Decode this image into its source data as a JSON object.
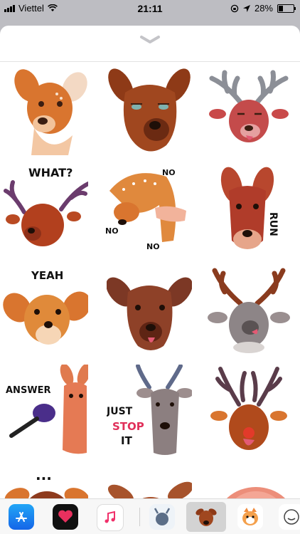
{
  "status_bar": {
    "carrier": "Viettel",
    "time": "21:11",
    "battery": "28%",
    "battery_level": 0.28,
    "icons": [
      "signal-bars-icon",
      "wifi-icon",
      "rotation-lock-icon",
      "location-arrow-icon",
      "battery-icon"
    ]
  },
  "sheet": {
    "grabber_icon": "chevron-down-icon"
  },
  "stickers": [
    {
      "name": "sticker-deer-doe-smirk",
      "text": ""
    },
    {
      "name": "sticker-deer-tired-eyes",
      "text": ""
    },
    {
      "name": "sticker-deer-antlers-tongue",
      "text": ""
    },
    {
      "name": "sticker-deer-what",
      "text": "WHAT?"
    },
    {
      "name": "sticker-deer-no-no",
      "text": "NO",
      "text2": "NO",
      "text3": "NO"
    },
    {
      "name": "sticker-deer-run",
      "text": "RUN"
    },
    {
      "name": "sticker-deer-yeah",
      "text": "YEAH"
    },
    {
      "name": "sticker-deer-tongue-out",
      "text": ""
    },
    {
      "name": "sticker-deer-grey-antlers",
      "text": ""
    },
    {
      "name": "sticker-deer-answer",
      "text": "ANSWER"
    },
    {
      "name": "sticker-deer-just-stop-it",
      "text": "JUST",
      "text2": "STOP",
      "text3": "IT"
    },
    {
      "name": "sticker-deer-red-nose",
      "text": ""
    },
    {
      "name": "sticker-deer-dots",
      "text": "..."
    },
    {
      "name": "sticker-deer-ears",
      "text": ""
    },
    {
      "name": "sticker-deer-pink",
      "text": ""
    }
  ],
  "app_drawer": {
    "apps": [
      {
        "name": "app-store-icon"
      },
      {
        "name": "digital-touch-icon"
      },
      {
        "name": "music-icon"
      },
      {
        "name": "deer-app-1-icon"
      },
      {
        "name": "deer-app-selected-icon"
      },
      {
        "name": "cat-app-icon"
      },
      {
        "name": "doodle-app-icon"
      }
    ]
  },
  "colors": {
    "brown_dark": "#6b2a12",
    "brown": "#a0471f",
    "orange": "#d9752f",
    "pink_nose": "#e35a74",
    "app_store_blue": "#1e8cf5",
    "heart_red": "#e8305e"
  }
}
